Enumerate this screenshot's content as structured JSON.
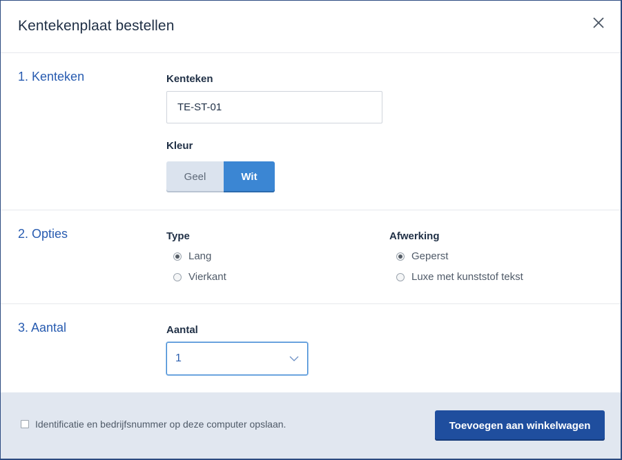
{
  "modal": {
    "title": "Kentekenplaat bestellen"
  },
  "section1": {
    "title": "1. Kenteken",
    "kenteken_label": "Kenteken",
    "kenteken_value": "TE-ST-01",
    "kleur_label": "Kleur",
    "kleur_options": [
      "Geel",
      "Wit"
    ],
    "kleur_selected": "Wit"
  },
  "section2": {
    "title": "2. Opties",
    "type_label": "Type",
    "type_options": [
      "Lang",
      "Vierkant"
    ],
    "type_selected": "Lang",
    "afwerking_label": "Afwerking",
    "afwerking_options": [
      "Geperst",
      "Luxe met kunststof tekst"
    ],
    "afwerking_selected": "Geperst"
  },
  "section3": {
    "title": "3. Aantal",
    "aantal_label": "Aantal",
    "aantal_value": "1"
  },
  "footer": {
    "checkbox_label": "Identificatie en bedrijfsnummer op deze computer opslaan.",
    "checkbox_checked": false,
    "submit_label": "Toevoegen aan winkelwagen"
  },
  "colors": {
    "accent": "#3b86d3",
    "primary_button": "#1f4e9e",
    "section_title": "#275bb0",
    "footer_bg": "#e1e7f0"
  }
}
